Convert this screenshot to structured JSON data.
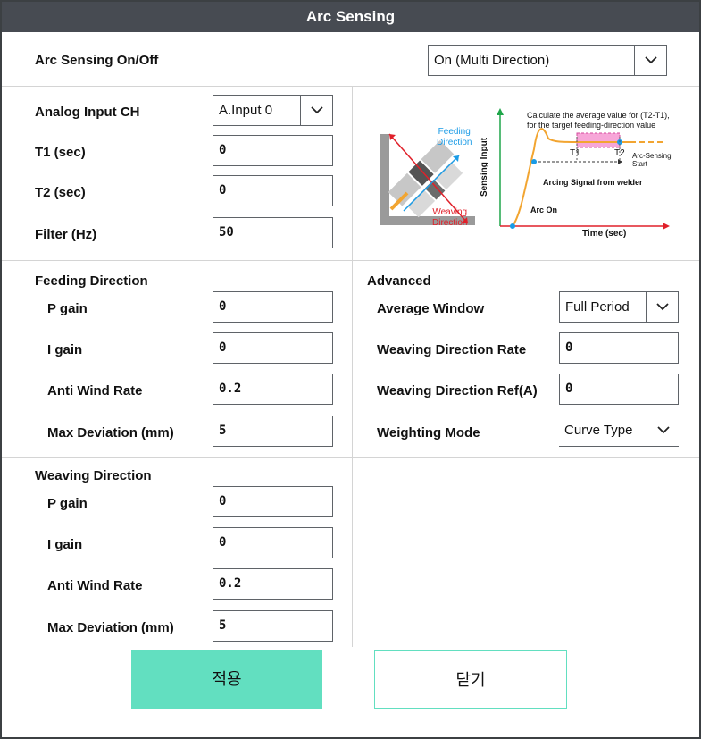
{
  "window": {
    "title": "Arc Sensing"
  },
  "arc_sensing": {
    "label": "Arc Sensing On/Off",
    "value": "On (Multi Direction)"
  },
  "basic": {
    "analog_label": "Analog Input CH",
    "analog_value": "A.Input 0",
    "t1_label": "T1 (sec)",
    "t1_value": "0",
    "t2_label": "T2 (sec)",
    "t2_value": "0",
    "filter_label": "Filter (Hz)",
    "filter_value": "50"
  },
  "diagram": {
    "feeding_label": [
      "Feeding",
      "Direction"
    ],
    "weaving_label": [
      "Weaving",
      "Direction"
    ],
    "chart_note": [
      "Calculate the average value for (T2-T1),",
      "for the target feeding-direction value"
    ],
    "y_axis_label": "Sensing Input",
    "x_axis_label": "Time (sec)",
    "t1": "T1",
    "t2": "T2",
    "arc_sensing_start": [
      "Arc-Sensing",
      "Start"
    ],
    "arcing_signal": "Arcing Signal from welder",
    "arc_on": "Arc On"
  },
  "feeding": {
    "title": "Feeding Direction",
    "p_gain_label": "P gain",
    "p_gain_value": "0",
    "i_gain_label": "I gain",
    "i_gain_value": "0",
    "anti_wind_label": "Anti Wind Rate",
    "anti_wind_value": "0.2",
    "max_dev_label": "Max Deviation (mm)",
    "max_dev_value": "5"
  },
  "advanced": {
    "title": "Advanced",
    "avg_window_label": "Average Window",
    "avg_window_value": "Full Period",
    "weaving_rate_label": "Weaving Direction Rate",
    "weaving_rate_value": "0",
    "weaving_ref_label": "Weaving Direction Ref(A)",
    "weaving_ref_value": "0",
    "weighting_label": "Weighting Mode",
    "weighting_value": "Curve Type"
  },
  "weaving": {
    "title": "Weaving Direction",
    "p_gain_label": "P gain",
    "p_gain_value": "0",
    "i_gain_label": "I gain",
    "i_gain_value": "0",
    "anti_wind_label": "Anti Wind Rate",
    "anti_wind_value": "0.2",
    "max_dev_label": "Max Deviation (mm)",
    "max_dev_value": "5"
  },
  "buttons": {
    "apply": "적용",
    "close": "닫기"
  },
  "colors": {
    "accent": "#62dfc0",
    "title_bar": "#474b52",
    "diagram_blue": "#1a9be6",
    "diagram_red": "#e0202a",
    "diagram_orange": "#f2a531",
    "diagram_pink": "#f7a6d8",
    "diagram_green": "#1fa64a"
  },
  "icons": [
    "chevron-down-icon",
    "torch-diagram",
    "sensing-chart"
  ]
}
